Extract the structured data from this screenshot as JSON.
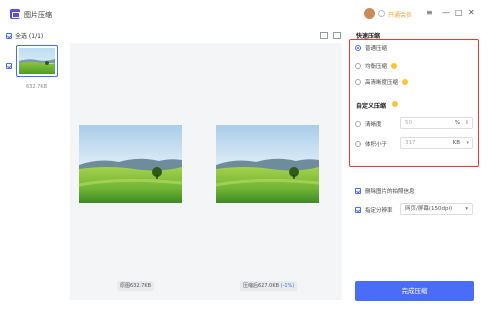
{
  "window": {
    "title": "图片压缩",
    "vip_label": "开通会员",
    "minimize": "—",
    "maximize": "□",
    "close": "✕",
    "menu": "≡"
  },
  "toolbar": {
    "select_all": "全选 (1/1)"
  },
  "thumbnail": {
    "size": "632.7KB"
  },
  "preview": {
    "before_label": "原图632.7KB",
    "after_label": "压缩后627.0KB",
    "after_pct": "(-1%)"
  },
  "settings": {
    "fast_title": "快速压缩",
    "fast_options": [
      {
        "label": "普通压缩",
        "selected": true,
        "help": false
      },
      {
        "label": "均衡压缩",
        "selected": false,
        "help": true
      },
      {
        "label": "高清晰度压缩",
        "selected": false,
        "help": true
      }
    ],
    "custom_title": "自定义压缩",
    "clarity": {
      "label": "清晰度",
      "value": "50",
      "unit": "%"
    },
    "filesize": {
      "label": "体积小于",
      "value": "317",
      "unit": "KB"
    },
    "strip_metadata": {
      "label": "删除图片的拍照信息",
      "checked": true
    },
    "resolution": {
      "label": "指定分辨率",
      "checked": true,
      "value": "网页/屏幕(150dpi)"
    },
    "compress_button": "完成压缩"
  },
  "colors": {
    "accent": "#4a6cf7",
    "highlight": "#e53935",
    "vip": "#f0a23a"
  }
}
